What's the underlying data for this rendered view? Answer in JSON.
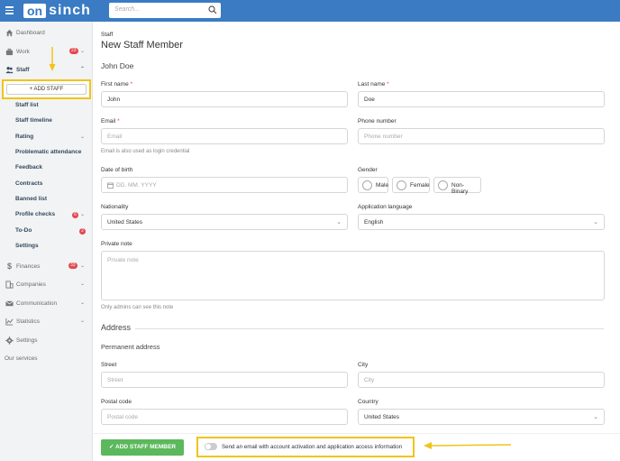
{
  "colors": {
    "topbar": "#3a7bc4",
    "accent_yellow": "#f0c419",
    "badge": "#e4474f",
    "submit": "#5cb85c"
  },
  "brand": {
    "logo_box": "on",
    "logo_rest": "sinch"
  },
  "search": {
    "placeholder": "Search..."
  },
  "sidebar": {
    "dashboard": "Dashboard",
    "work": "Work",
    "work_badge": "23",
    "staff": "Staff",
    "add_staff": "+ ADD STAFF",
    "staff_subitems": [
      "Staff list",
      "Staff timeline",
      "Rating",
      "Problematic attendance",
      "Feedback",
      "Contracts",
      "Banned list",
      "Profile checks",
      "To-Do",
      "Settings"
    ],
    "profile_checks_badge": "6",
    "todo_badge": "2",
    "finances": "Finances",
    "finances_badge": "33",
    "companies": "Companies",
    "communication": "Communication",
    "statistics": "Statistics",
    "settings": "Settings",
    "our_services": "Our services"
  },
  "page": {
    "breadcrumb": "Staff",
    "title": "New Staff Member",
    "person_name": "John Doe"
  },
  "form": {
    "first_name_label": "First name",
    "first_name_value": "John",
    "last_name_label": "Last name",
    "last_name_value": "Doe",
    "email_label": "Email",
    "email_placeholder": "Email",
    "email_hint": "Email is also used as login credential",
    "phone_label": "Phone number",
    "phone_placeholder": "Phone number",
    "dob_label": "Date of birth",
    "dob_placeholder": "DD. MM. YYYY",
    "gender_label": "Gender",
    "gender_options": [
      "Male",
      "Female",
      "Non-Binary"
    ],
    "nationality_label": "Nationality",
    "nationality_value": "United States",
    "app_lang_label": "Application language",
    "app_lang_value": "English",
    "note_label": "Private note",
    "note_placeholder": "Private note",
    "note_hint": "Only admins can see this note",
    "address_heading": "Address",
    "permanent_heading": "Permanent address",
    "street_label": "Street",
    "street_placeholder": "Street",
    "city_label": "City",
    "city_placeholder": "City",
    "postal_label": "Postal code",
    "postal_placeholder": "Postal code",
    "country_label": "Country",
    "country_value": "United States"
  },
  "footer": {
    "submit_label": "ADD STAFF MEMBER",
    "toggle_text": "Send an email with account activation and application access information"
  }
}
